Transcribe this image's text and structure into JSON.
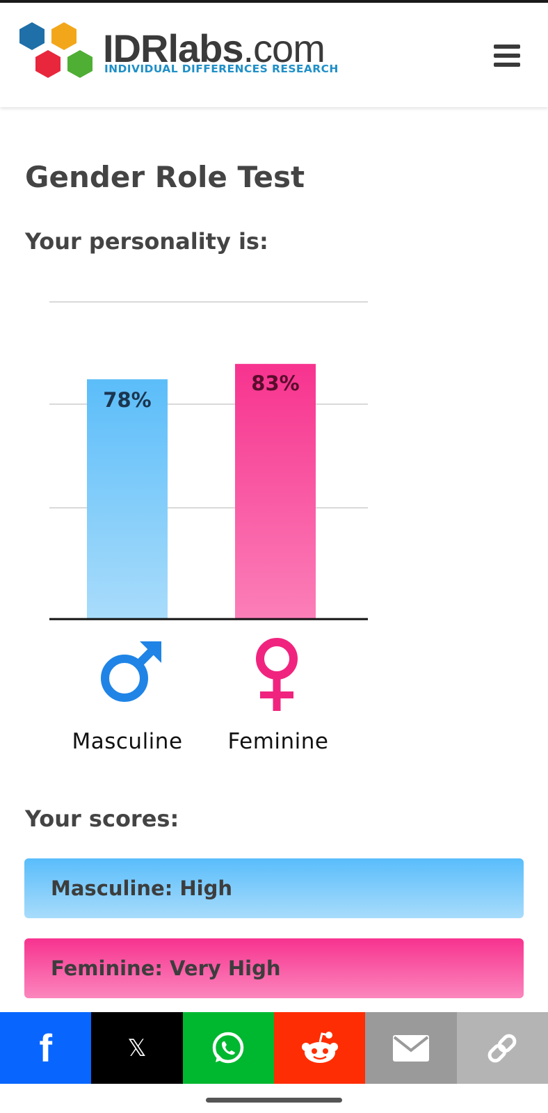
{
  "header": {
    "logo_name_bold": "IDRlabs",
    "logo_name_light": ".com",
    "logo_tagline": "INDIVIDUAL DIFFERENCES RESEARCH",
    "logo_colors": [
      "#1f6fa8",
      "#f2a71b",
      "#e8273d",
      "#4fae34"
    ],
    "menu_icon": "hamburger-icon"
  },
  "page": {
    "title": "Gender Role Test",
    "subtitle": "Your personality is:",
    "scores_title": "Your scores:"
  },
  "chart_data": {
    "type": "bar",
    "categories": [
      "Masculine",
      "Feminine"
    ],
    "values": [
      78,
      83
    ],
    "value_labels": [
      "78%",
      "83%"
    ],
    "ylim": [
      0,
      100
    ],
    "grid": true,
    "colors": [
      "#5bbdf9",
      "#f7338f"
    ],
    "category_icons": [
      "male-symbol-icon",
      "female-symbol-icon"
    ]
  },
  "scores": [
    {
      "text": "Masculine: High",
      "color": "#59bdfb"
    },
    {
      "text": "Feminine: Very High",
      "color": "#f7338f"
    }
  ],
  "share": [
    {
      "name": "facebook",
      "icon": "facebook-icon",
      "color": "#0866ff"
    },
    {
      "name": "x",
      "icon": "x-icon",
      "color": "#000000"
    },
    {
      "name": "whatsapp",
      "icon": "whatsapp-icon",
      "color": "#00b730"
    },
    {
      "name": "reddit",
      "icon": "reddit-icon",
      "color": "#ff2d03"
    },
    {
      "name": "email",
      "icon": "email-icon",
      "color": "#9a9a9a"
    },
    {
      "name": "copy-link",
      "icon": "link-icon",
      "color": "#b4b4b4"
    }
  ]
}
